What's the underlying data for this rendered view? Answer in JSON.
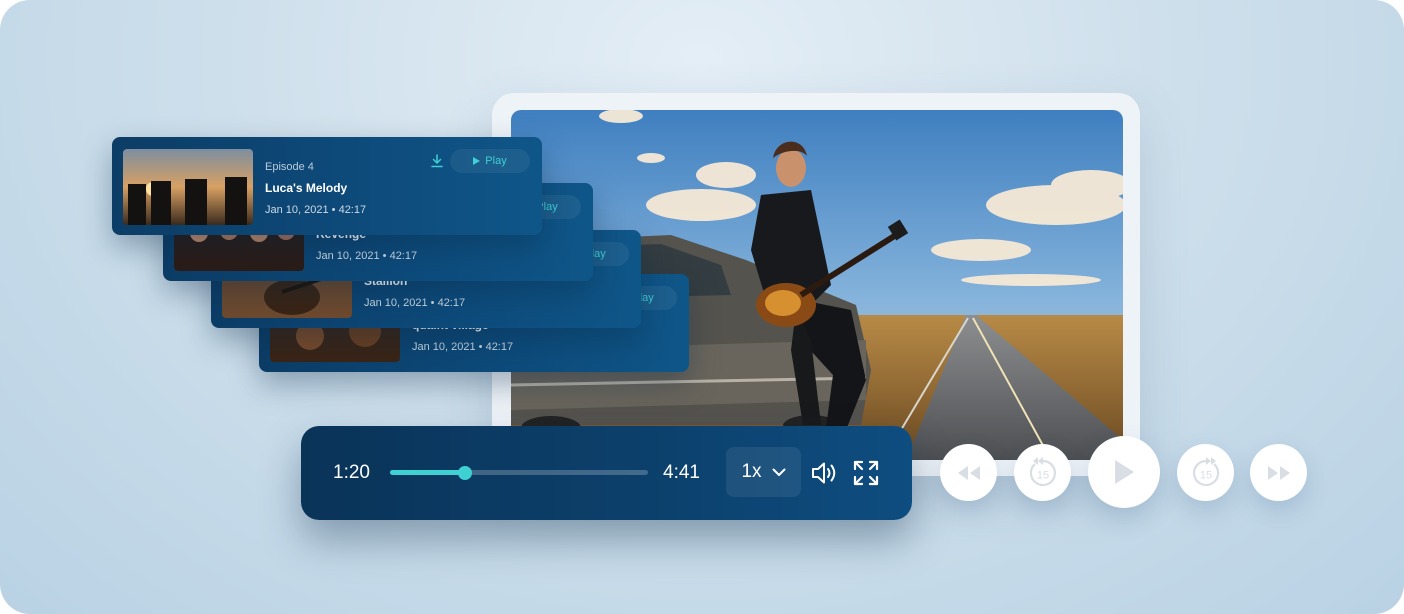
{
  "player": {
    "current_time": "1:20",
    "total_time": "4:41",
    "progress": 0.29,
    "speed": "1x",
    "skip_seconds_back": "15",
    "skip_seconds_forward": "15"
  },
  "episodes": [
    {
      "episode": "Episode 4",
      "title": "Luca's Melody",
      "meta": "Jan 10, 2021 • 42:17",
      "play_label": "Play"
    },
    {
      "title": "Revenge",
      "meta": "Jan 10, 2021 • 42:17",
      "play_label": "Play"
    },
    {
      "title": "Stallion",
      "meta": "Jan 10, 2021 • 42:17",
      "play_label": "Play"
    },
    {
      "title": "quaint village",
      "meta": "Jan 10, 2021 • 42:17",
      "play_label": "Play"
    }
  ],
  "icons": [
    "download-icon",
    "play-icon",
    "volume-icon",
    "fullscreen-icon",
    "rewind-icon",
    "replay-15-icon",
    "forward-15-icon",
    "fast-forward-icon",
    "chevron-down-icon"
  ],
  "colors": {
    "accent": "#3fd0d4",
    "panel": "#0c416d",
    "background": "#cfe0ec"
  }
}
